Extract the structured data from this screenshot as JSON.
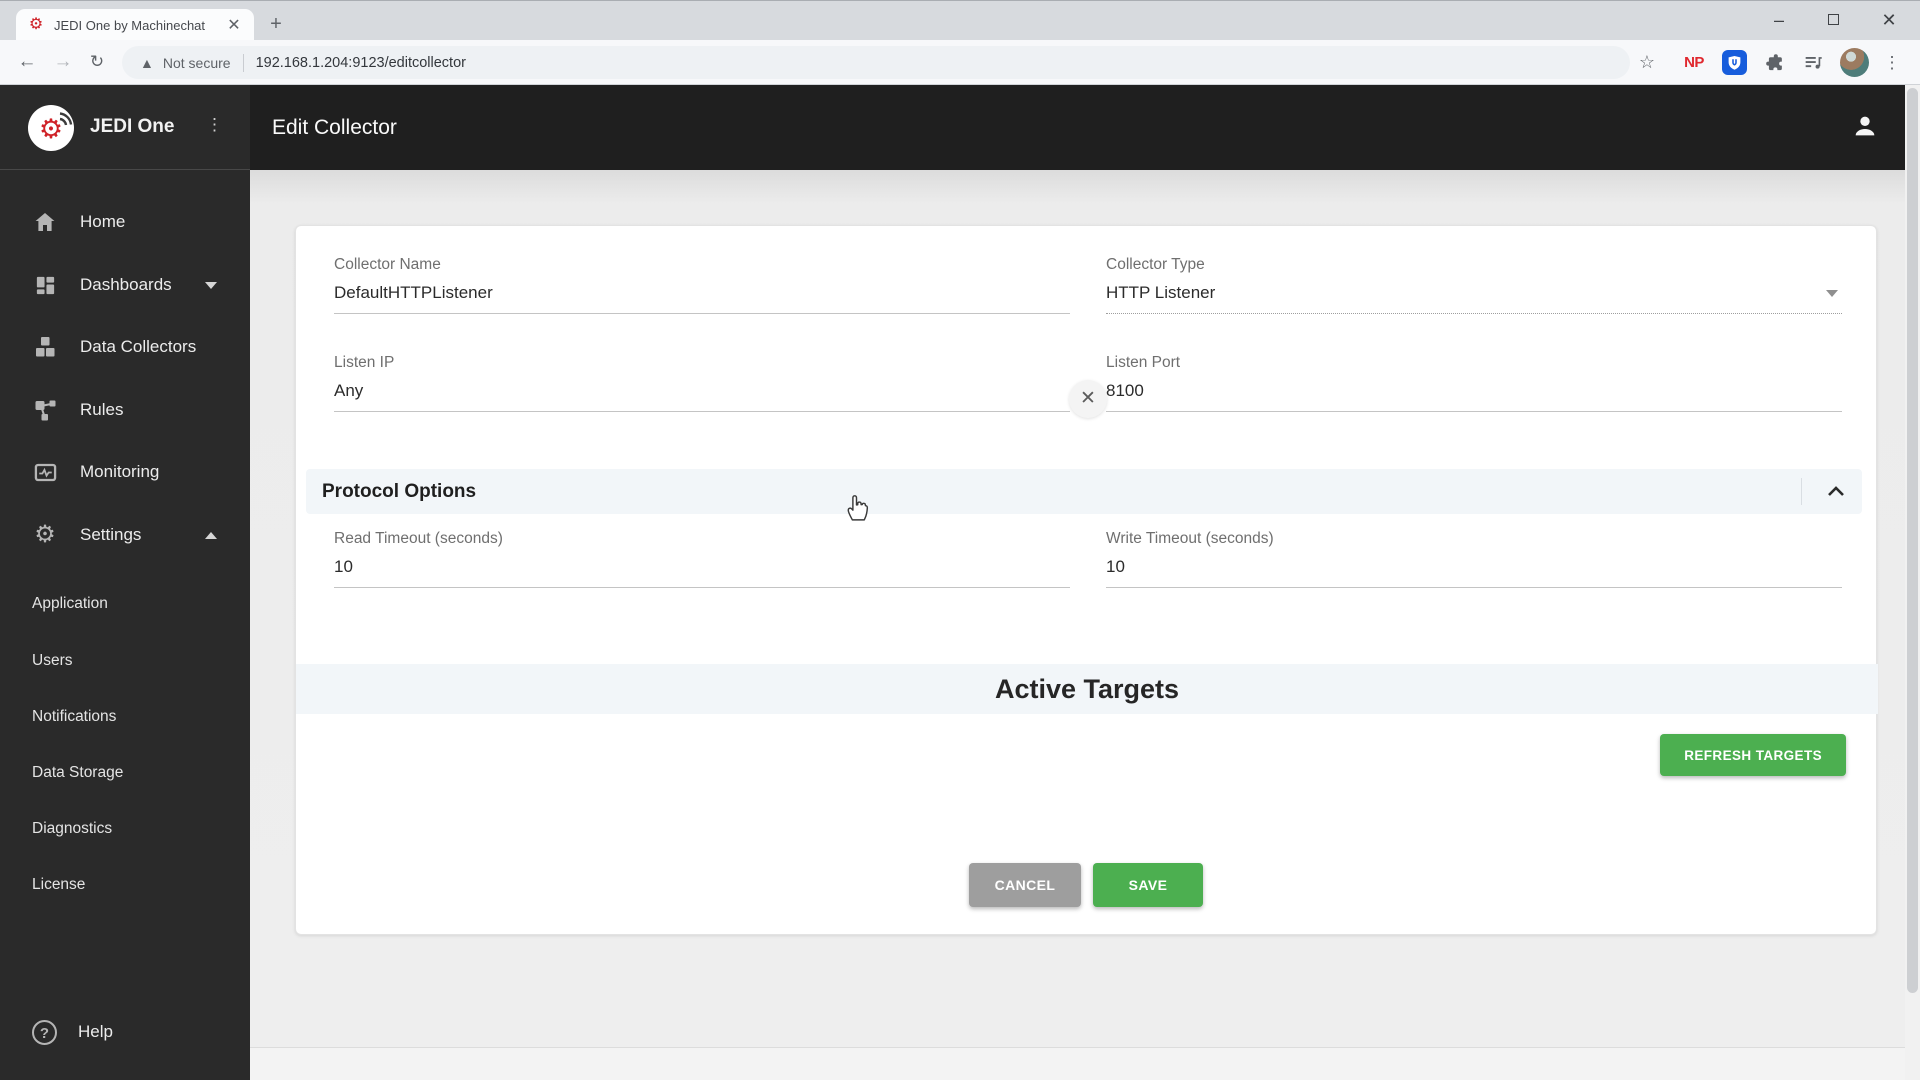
{
  "browser": {
    "tab": {
      "title": "JEDI One by Machinechat"
    },
    "address": {
      "security": "Not secure",
      "url": "192.168.1.204:9123/editcollector"
    },
    "extensions": {
      "np_label": "NP",
      "shield_letter": "U"
    }
  },
  "sidebar": {
    "brand": "JEDI One",
    "items": [
      {
        "label": "Home"
      },
      {
        "label": "Dashboards"
      },
      {
        "label": "Data Collectors"
      },
      {
        "label": "Rules"
      },
      {
        "label": "Monitoring"
      },
      {
        "label": "Settings"
      }
    ],
    "settings_children": [
      {
        "label": "Application"
      },
      {
        "label": "Users"
      },
      {
        "label": "Notifications"
      },
      {
        "label": "Data Storage"
      },
      {
        "label": "Diagnostics"
      },
      {
        "label": "License"
      }
    ],
    "help": {
      "label": "Help"
    }
  },
  "appbar": {
    "title": "Edit Collector"
  },
  "form": {
    "collector_name": {
      "label": "Collector Name",
      "value": "DefaultHTTPListener"
    },
    "collector_type": {
      "label": "Collector Type",
      "value": "HTTP Listener"
    },
    "listen_ip": {
      "label": "Listen IP",
      "value": "Any"
    },
    "listen_port": {
      "label": "Listen Port",
      "value": "8100"
    },
    "protocol_options": {
      "title": "Protocol Options",
      "read_timeout": {
        "label": "Read Timeout (seconds)",
        "value": "10"
      },
      "write_timeout": {
        "label": "Write Timeout (seconds)",
        "value": "10"
      }
    },
    "active_targets": {
      "title": "Active Targets",
      "refresh_button": "REFRESH TARGETS"
    },
    "actions": {
      "cancel": "CANCEL",
      "save": "SAVE"
    }
  },
  "colors": {
    "accent_green": "#4caf50",
    "cancel_gray": "#9e9e9e",
    "brand_red": "#cf2127",
    "sidebar_bg": "#2a2a2a",
    "appbar_bg": "#1f1f1f",
    "bitwarden_blue": "#175ddc",
    "section_band": "#f2f6f9"
  }
}
